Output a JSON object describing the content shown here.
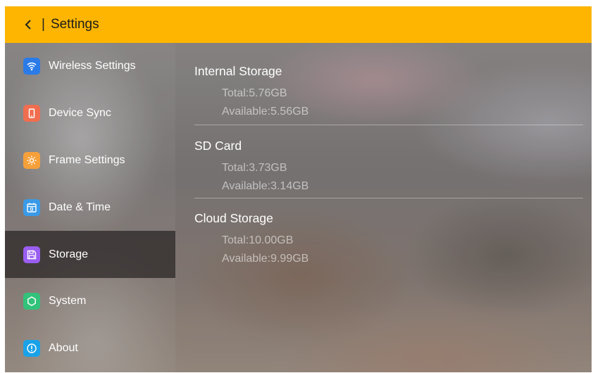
{
  "header": {
    "separator": "|",
    "title": "Settings"
  },
  "sidebar": {
    "items": [
      {
        "label": "Wireless Settings",
        "icon": "wifi-icon",
        "color": "#2a7be8",
        "active": false
      },
      {
        "label": "Device Sync",
        "icon": "phone-icon",
        "color": "#f06e4f",
        "active": false
      },
      {
        "label": "Frame Settings",
        "icon": "brightness-icon",
        "color": "#f6a03a",
        "active": false
      },
      {
        "label": "Date & Time",
        "icon": "calendar-icon",
        "color": "#3a9ae8",
        "active": false
      },
      {
        "label": "Storage",
        "icon": "save-icon",
        "color": "#9a5ef0",
        "active": true
      },
      {
        "label": "System",
        "icon": "hexagon-icon",
        "color": "#32c27a",
        "active": false
      },
      {
        "label": "About",
        "icon": "info-icon",
        "color": "#1aa2e8",
        "active": false
      }
    ]
  },
  "storage": {
    "internal": {
      "title": "Internal Storage",
      "total": "Total:5.76GB",
      "available": "Available:5.56GB"
    },
    "sd": {
      "title": "SD Card",
      "total": "Total:3.73GB",
      "available": "Available:3.14GB"
    },
    "cloud": {
      "title": "Cloud Storage",
      "total": "Total:10.00GB",
      "available": "Available:9.99GB"
    }
  },
  "colors": {
    "header_bg": "#fdb501",
    "active_item_bg": "#2b2626"
  }
}
